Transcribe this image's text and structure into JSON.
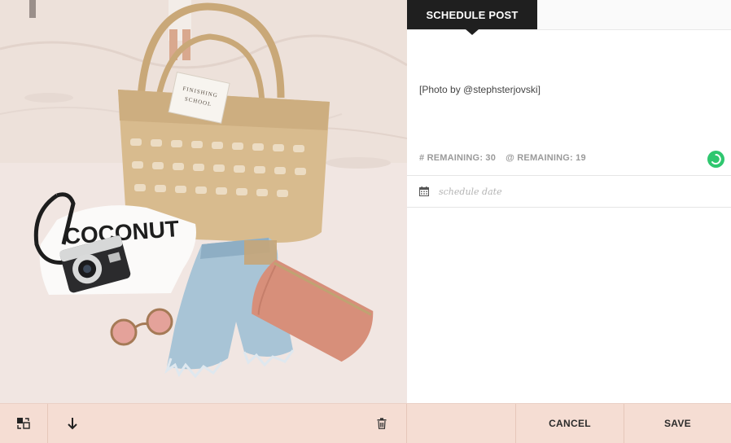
{
  "tabs": {
    "active_label": "SCHEDULE POST"
  },
  "post": {
    "caption": "[Photo by @stephsterjovski]",
    "hashtags_remaining_label": "# REMAINING: 30",
    "mentions_remaining_label": "@ REMAINING: 19",
    "status_color": "#2fc76f"
  },
  "schedule": {
    "date_placeholder": "schedule date",
    "date_value": ""
  },
  "photo": {
    "shirt_print": "COCONUT",
    "tag_text_1": "FINISHING",
    "tag_text_2": "SCHOOL"
  },
  "toolbar": {
    "swap_icon": "swap-icon",
    "download_icon": "arrow-down-icon",
    "delete_icon": "trash-icon",
    "cancel_label": "CANCEL",
    "save_label": "SAVE"
  },
  "colors": {
    "bottom_bar": "#f5ddd3",
    "tab_active": "#1f1f1f",
    "accent_green": "#2fc76f"
  }
}
